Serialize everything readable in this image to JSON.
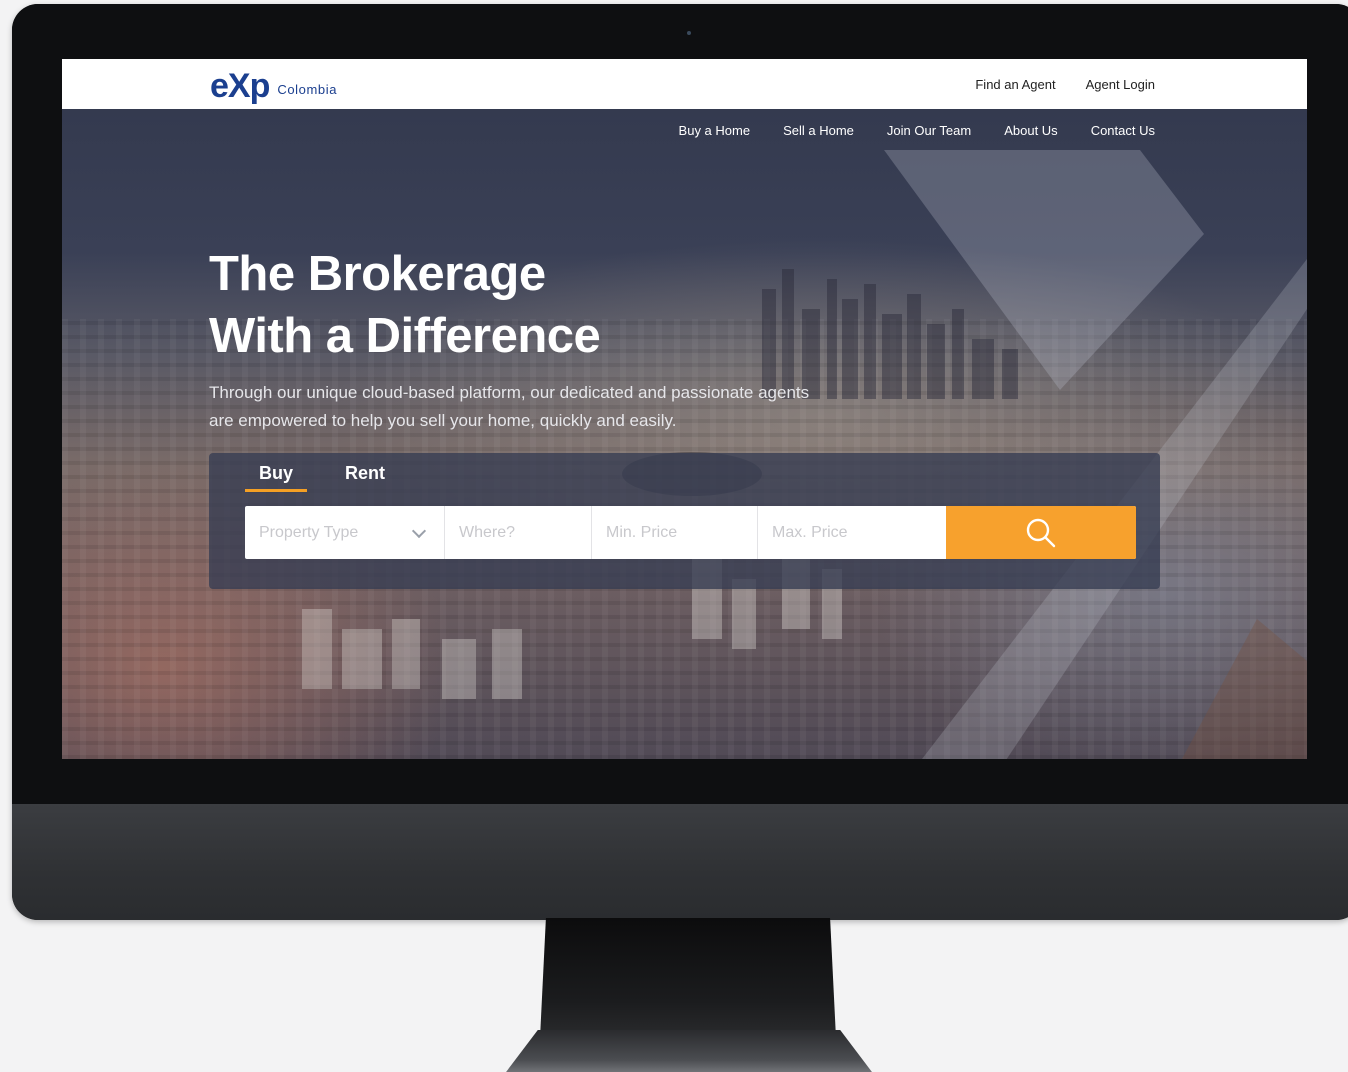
{
  "brand": {
    "logo_text": "eXp",
    "logo_sub": "Colombia",
    "brand_color": "#1b3f8f",
    "accent_color": "#f7a12d"
  },
  "top_links": [
    {
      "label": "Find an Agent"
    },
    {
      "label": "Agent Login"
    }
  ],
  "nav": [
    {
      "label": "Buy a Home"
    },
    {
      "label": "Sell a Home"
    },
    {
      "label": "Join Our Team"
    },
    {
      "label": "About Us"
    },
    {
      "label": "Contact Us"
    }
  ],
  "hero": {
    "title_line1": "The Brokerage",
    "title_line2": "With a Difference",
    "subtitle_line1": "Through our unique cloud-based platform, our dedicated and passionate agents",
    "subtitle_line2": "are empowered to help you sell your home, quickly and easily."
  },
  "search": {
    "tabs": [
      {
        "label": "Buy",
        "active": true
      },
      {
        "label": "Rent",
        "active": false
      }
    ],
    "property_type_placeholder": "Property Type",
    "where_placeholder": "Where?",
    "min_price_placeholder": "Min. Price",
    "max_price_placeholder": "Max. Price",
    "button_icon": "search-icon"
  }
}
